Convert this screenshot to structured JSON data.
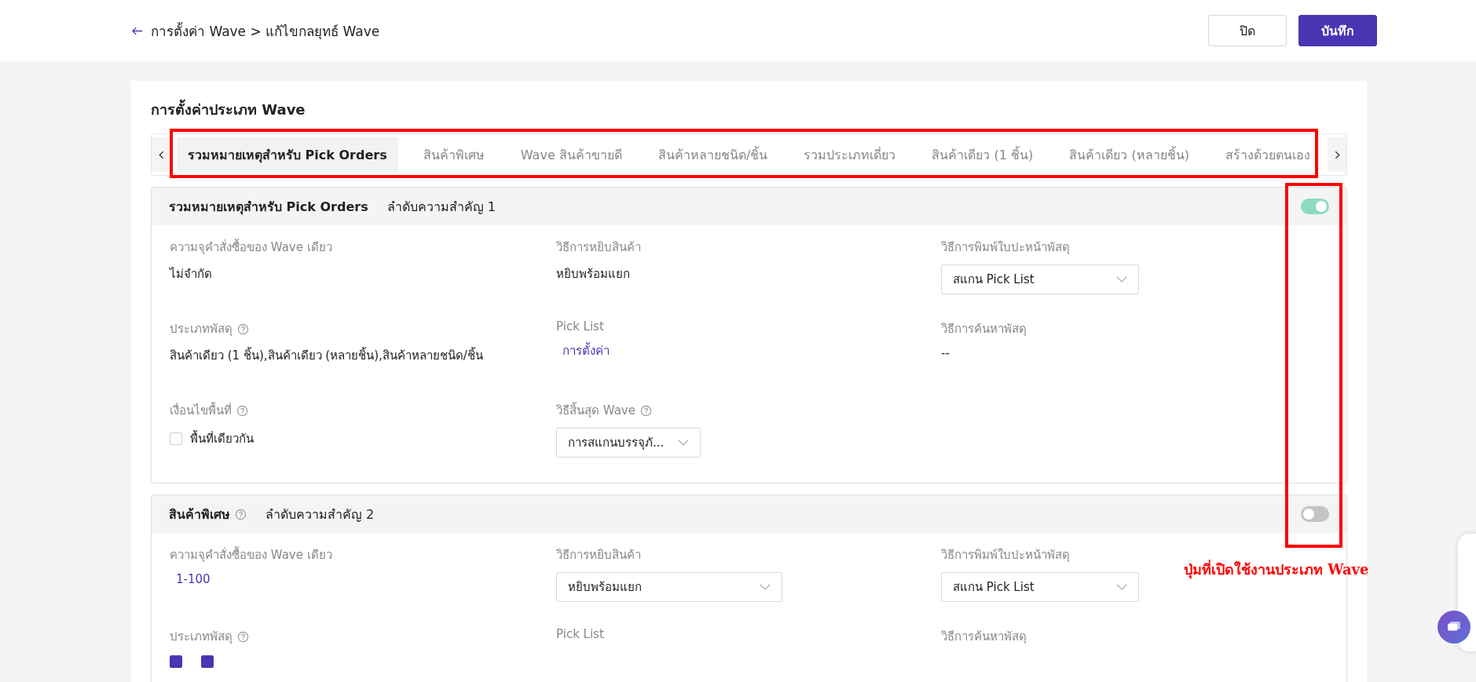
{
  "header": {
    "breadcrumb": "การตั้งค่า Wave > แก้ไขกลยุทธ์ Wave",
    "buttons": [
      {
        "label": "ปิด",
        "kind": "secondary"
      },
      {
        "label": "บันทึก",
        "kind": "primary"
      }
    ]
  },
  "card": {
    "title": "การตั้งค่าประเภท Wave",
    "tabs": [
      {
        "label": "รวมหมายเหตุสำหรับ Pick Orders",
        "selected": true
      },
      {
        "label": "สินค้าพิเศษ",
        "selected": false
      },
      {
        "label": "Wave สินค้าขายดี",
        "selected": false
      },
      {
        "label": "สินค้าหลายชนิด/ชิ้น",
        "selected": false
      },
      {
        "label": "รวมประเภทเดี่ยว",
        "selected": false
      },
      {
        "label": "สินค้าเดียว (1 ชิ้น)",
        "selected": false
      },
      {
        "label": "สินค้าเดียว (หลายชิ้น)",
        "selected": false
      },
      {
        "label": "สร้างด้วยตนเอง",
        "selected": false
      }
    ]
  },
  "sections": [
    {
      "name": "รวมหมายเหตุสำหรับ Pick Orders",
      "help": false,
      "priority": "ลำดับความสำคัญ 1",
      "enabled": true,
      "rows": [
        [
          {
            "label": "ความจุคำสั่งซื้อของ Wave เดียว",
            "help": false,
            "kind": "text",
            "value": "ไม่จำกัด"
          },
          {
            "label": "วิธีการหยิบสินค้า",
            "help": false,
            "kind": "text",
            "value": "หยิบพร้อมแยก"
          },
          {
            "label": "วิธีการพิมพ์ใบปะหน้าพัสดุ",
            "help": false,
            "kind": "select",
            "value": "สแกน Pick List"
          }
        ],
        [
          {
            "label": "ประเภทพัสดุ",
            "help": true,
            "kind": "text",
            "value": "สินค้าเดียว (1 ชิ้น),สินค้าเดียว (หลายชิ้น),สินค้าหลายชนิด/ชิ้น"
          },
          {
            "label": "Pick List",
            "help": false,
            "kind": "link",
            "value": "การตั้งค่า"
          },
          {
            "label": "วิธีการค้นหาพัสดุ",
            "help": false,
            "kind": "text",
            "value": "--"
          }
        ],
        [
          {
            "label": "เงื่อนไขพื้นที่",
            "help": true,
            "kind": "checkbox",
            "options": [
              {
                "label": "พื้นที่เดียวกัน",
                "checked": false
              }
            ]
          },
          {
            "label": "วิธีสิ้นสุด Wave",
            "help": true,
            "kind": "select",
            "value": "การสแกนบรรจุภั..."
          }
        ]
      ]
    },
    {
      "name": "สินค้าพิเศษ",
      "help": true,
      "priority": "ลำดับความสำคัญ 2",
      "enabled": false,
      "rows": [
        [
          {
            "label": "ความจุคำสั่งซื้อของ Wave เดียว",
            "help": false,
            "kind": "link",
            "value": "1-100"
          },
          {
            "label": "วิธีการหยิบสินค้า",
            "help": false,
            "kind": "select",
            "value": "หยิบพร้อมแยก"
          },
          {
            "label": "วิธีการพิมพ์ใบปะหน้าพัสดุ",
            "help": false,
            "kind": "select",
            "value": "สแกน Pick List"
          }
        ],
        [
          {
            "label": "ประเภทพัสดุ",
            "help": true,
            "kind": "checkbox",
            "options": [
              {
                "checked": true
              },
              {
                "checked": true
              }
            ]
          },
          {
            "label": "Pick List",
            "help": false,
            "kind": "text"
          },
          {
            "label": "วิธีการค้นหาพัสดุ",
            "help": false,
            "kind": "text"
          }
        ]
      ]
    }
  ],
  "annotation": {
    "note": "ปุ่มที่เปิดใช้งานประเภท Wave"
  }
}
